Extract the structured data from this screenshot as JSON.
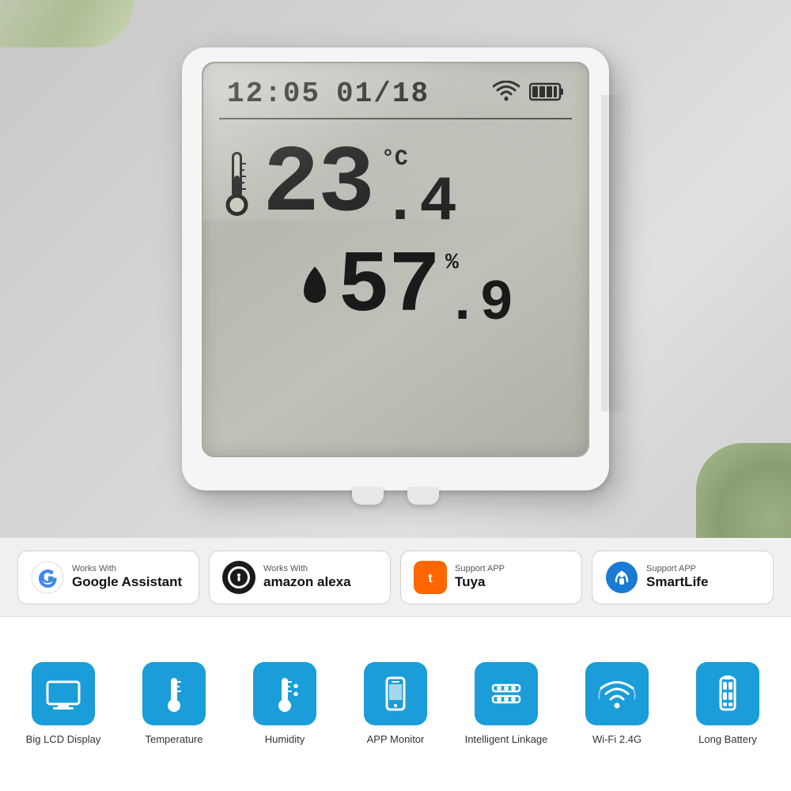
{
  "product": {
    "device": {
      "time": "12:05",
      "date": "01/18",
      "temperature": "23",
      "temp_decimal": ".4",
      "temp_unit": "°C",
      "humidity": "57",
      "humidity_decimal": ".9",
      "humidity_unit": "%"
    }
  },
  "badges": [
    {
      "id": "google-assistant",
      "small_text": "Works With",
      "large_text": "Google Assistant",
      "logo_type": "google"
    },
    {
      "id": "amazon-alexa",
      "small_text": "Works With",
      "large_text": "amazon alexa",
      "logo_type": "alexa"
    },
    {
      "id": "tuya",
      "small_text": "Support APP",
      "large_text": "Tuya",
      "logo_type": "tuya"
    },
    {
      "id": "smartlife",
      "small_text": "Support APP",
      "large_text": "SmartLife",
      "logo_type": "smartlife"
    }
  ],
  "features": [
    {
      "id": "lcd",
      "label": "Big LCD Display",
      "icon": "lcd"
    },
    {
      "id": "temperature",
      "label": "Temperature",
      "icon": "thermometer"
    },
    {
      "id": "humidity",
      "label": "Humidity",
      "icon": "humidity"
    },
    {
      "id": "app",
      "label": "APP Monitor",
      "icon": "phone"
    },
    {
      "id": "linkage",
      "label": "Intelligent Linkage",
      "icon": "linkage"
    },
    {
      "id": "wifi",
      "label": "Wi-Fi 2.4G",
      "icon": "wifi"
    },
    {
      "id": "battery",
      "label": "Long Battery",
      "icon": "battery"
    }
  ]
}
